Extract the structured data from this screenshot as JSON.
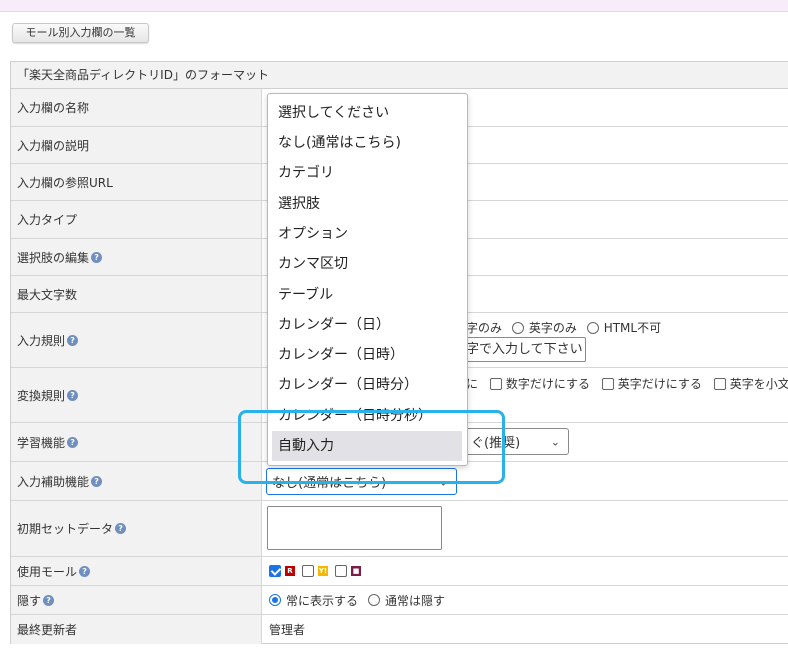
{
  "list_button": "モール別入力欄の一覧",
  "panel_title": "「楽天全商品ディレクトリID」のフォーマット",
  "rows": {
    "name": "入力欄の名称",
    "desc": "入力欄の説明",
    "ref_url": "入力欄の参照URL",
    "input_type": "入力タイプ",
    "choice_edit": "選択肢の編集",
    "max_chars": "最大文字数",
    "input_rule": "入力規則",
    "convert_rule": "変換規則",
    "learning": "学習機能",
    "assist": "入力補助機能",
    "initial_set": "初期セットデータ",
    "use_mall": "使用モール",
    "hide": "隠す",
    "last_updater": "最終更新者"
  },
  "input_rule": {
    "opt_partial": "字のみ",
    "opt_alpha": "英字のみ",
    "opt_html": "HTML不可",
    "message_value": "字で入力して下さい"
  },
  "convert_rule": {
    "opt_partial": "に",
    "opt_digits": "数字だけにする",
    "opt_alpha": "英字だけにする",
    "opt_lower": "英字を小文"
  },
  "learning_value": "ぐ(推奨)",
  "assist_value": "なし(通常はこちら)",
  "mall_logos": {
    "rakuten": "R",
    "yahoo": "Y!",
    "other": "■",
    "rakuten_color": "#bf0000",
    "yahoo_color": "#f5b800",
    "other_color": "#7a1f4a"
  },
  "hide": {
    "always_show": "常に表示する",
    "normally_hide": "通常は隠す"
  },
  "last_updater_value": "管理者",
  "dropdown_options": [
    "選択してください",
    "なし(通常はこちら)",
    "カテゴリ",
    "選択肢",
    "オプション",
    "カンマ区切",
    "テーブル",
    "カレンダー（日）",
    "カレンダー（日時）",
    "カレンダー（日時分）",
    "カレンダー（日時分秒）",
    "自動入力"
  ],
  "colors": {
    "accent": "#1a73e8",
    "highlight": "#29b1ea",
    "label_bg": "#f2f2f2",
    "help_icon": "#6f8fbf"
  },
  "icons": {
    "help": "question-circle-icon",
    "chevron": "chevron-down-icon"
  }
}
